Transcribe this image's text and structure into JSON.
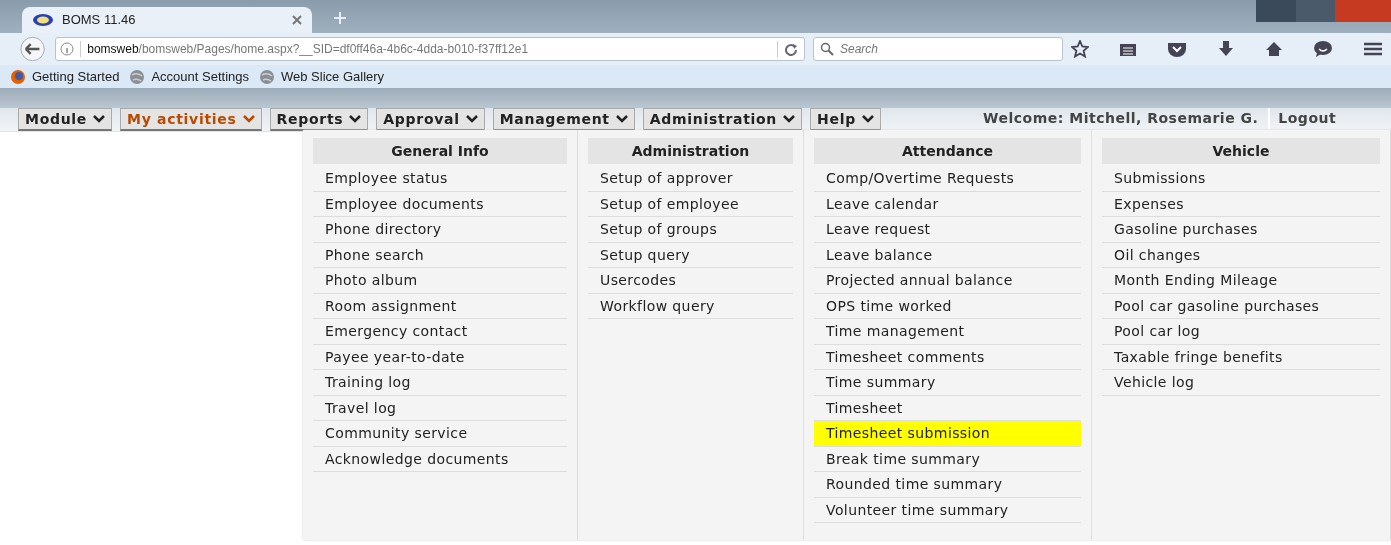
{
  "browser": {
    "tab_title": "BOMS 11.46",
    "url_host": "bomsweb",
    "url_path": "/bomsweb/Pages/home.aspx?__SID=df0ff46a-4b6c-4dda-b010-f37ff12e1",
    "search_placeholder": "Search",
    "bookmarks": [
      "Getting Started",
      "Account Settings",
      "Web Slice Gallery"
    ]
  },
  "menu": [
    {
      "label": "Module",
      "selected": false
    },
    {
      "label": "My activities",
      "selected": true
    },
    {
      "label": "Reports",
      "selected": false
    },
    {
      "label": "Approval",
      "selected": false
    },
    {
      "label": "Management",
      "selected": false
    },
    {
      "label": "Administration",
      "selected": false
    },
    {
      "label": "Help",
      "selected": false
    }
  ],
  "welcome": "Welcome: Mitchell, Rosemarie G.",
  "logout": "Logout",
  "dropdown": [
    {
      "title": "General Info",
      "items": [
        {
          "label": "Employee status",
          "selected": false
        },
        {
          "label": "Employee documents",
          "selected": false
        },
        {
          "label": "Phone directory",
          "selected": false
        },
        {
          "label": "Phone search",
          "selected": false
        },
        {
          "label": "Photo album",
          "selected": false
        },
        {
          "label": "Room assignment",
          "selected": false
        },
        {
          "label": "Emergency contact",
          "selected": false
        },
        {
          "label": "Payee year-to-date",
          "selected": false
        },
        {
          "label": "Training log",
          "selected": false
        },
        {
          "label": "Travel log",
          "selected": false
        },
        {
          "label": "Community service",
          "selected": false
        },
        {
          "label": "Acknowledge documents",
          "selected": false
        }
      ]
    },
    {
      "title": "Administration",
      "items": [
        {
          "label": "Setup of approver",
          "selected": false
        },
        {
          "label": "Setup of employee",
          "selected": false
        },
        {
          "label": "Setup of groups",
          "selected": false
        },
        {
          "label": "Setup query",
          "selected": false
        },
        {
          "label": "Usercodes",
          "selected": false
        },
        {
          "label": "Workflow query",
          "selected": false
        }
      ]
    },
    {
      "title": "Attendance",
      "items": [
        {
          "label": "Comp/Overtime Requests",
          "selected": false
        },
        {
          "label": "Leave calendar",
          "selected": false
        },
        {
          "label": "Leave request",
          "selected": false
        },
        {
          "label": "Leave balance",
          "selected": false
        },
        {
          "label": "Projected annual balance",
          "selected": false
        },
        {
          "label": "OPS time worked",
          "selected": false
        },
        {
          "label": "Time management",
          "selected": false
        },
        {
          "label": "Timesheet comments",
          "selected": false
        },
        {
          "label": "Time summary",
          "selected": false
        },
        {
          "label": "Timesheet",
          "selected": false
        },
        {
          "label": "Timesheet submission",
          "selected": true
        },
        {
          "label": "Break time summary",
          "selected": false
        },
        {
          "label": "Rounded time summary",
          "selected": false
        },
        {
          "label": "Volunteer time summary",
          "selected": false
        }
      ]
    },
    {
      "title": "Vehicle",
      "items": [
        {
          "label": "Submissions",
          "selected": false
        },
        {
          "label": "Expenses",
          "selected": false
        },
        {
          "label": "Gasoline purchases",
          "selected": false
        },
        {
          "label": "Oil changes",
          "selected": false
        },
        {
          "label": "Month Ending Mileage",
          "selected": false
        },
        {
          "label": "Pool car gasoline purchases",
          "selected": false
        },
        {
          "label": "Pool car log",
          "selected": false
        },
        {
          "label": "Taxable fringe benefits",
          "selected": false
        },
        {
          "label": "Vehicle log",
          "selected": false
        }
      ]
    }
  ]
}
